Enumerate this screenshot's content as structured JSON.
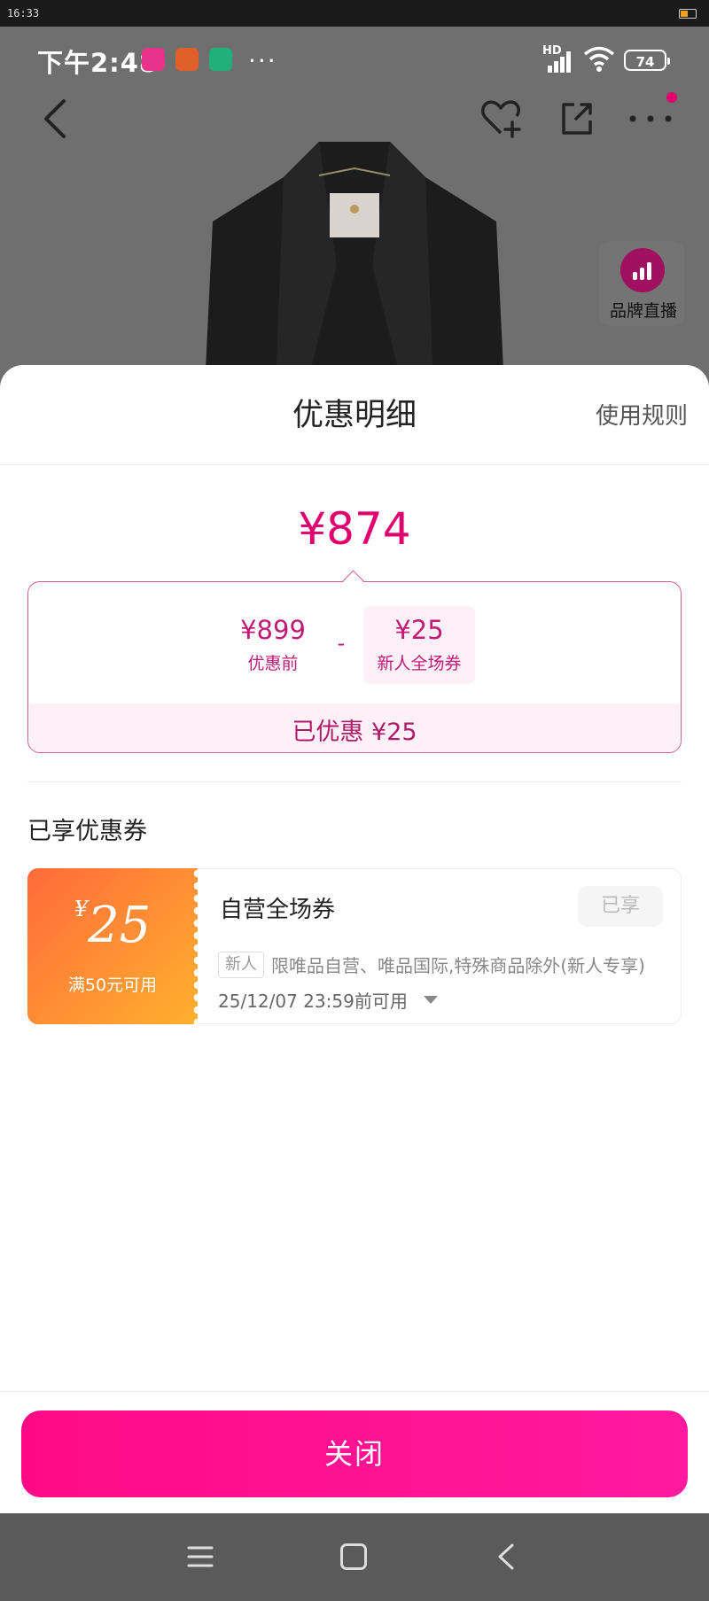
{
  "system_bar": {
    "time": "16:33"
  },
  "status": {
    "time": "下午2:48",
    "dots": "···",
    "signal_label": "HD",
    "battery": "74"
  },
  "product": {
    "live_label": "品牌直播"
  },
  "sheet": {
    "title": "优惠明细",
    "rules_link": "使用规则",
    "final_price": "¥874",
    "breakdown": {
      "original_price": "¥899",
      "original_label": "优惠前",
      "operator": "-",
      "coupon_amount": "¥25",
      "coupon_label": "新人全场券",
      "saved_text": "已优惠 ¥25"
    },
    "section_title": "已享优惠券",
    "coupon": {
      "currency": "¥",
      "amount": "25",
      "condition": "满50元可用",
      "name": "自营全场券",
      "status": "已享",
      "tag": "新人",
      "description": "限唯品自营、唯品国际,特殊商品除外(新人专享)",
      "expiry": "25/12/07 23:59前可用"
    },
    "close_button": "关闭"
  },
  "colors": {
    "accent": "#e0006e",
    "button": "#ff0a86",
    "coupon_gradient_start": "#ff6a3a",
    "coupon_gradient_end": "#ffb02e"
  }
}
